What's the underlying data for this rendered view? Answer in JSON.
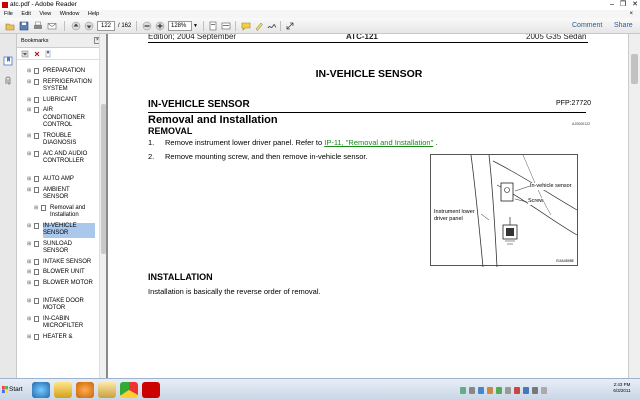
{
  "window": {
    "title": "atc.pdf - Adobe Reader",
    "controls": [
      "–",
      "❐",
      "✕"
    ]
  },
  "menu": {
    "items": [
      "File",
      "Edit",
      "View",
      "Window",
      "Help"
    ],
    "close": "×"
  },
  "toolbar": {
    "current_page": "122",
    "total_pages": "/ 162",
    "zoom": "128%",
    "comment_label": "Comment",
    "share_label": "Share"
  },
  "bookmarks": {
    "title": "Bookmarks",
    "items": [
      {
        "label": "PREPARATION",
        "lines": 1,
        "level": 0,
        "selected": false
      },
      {
        "label": "REFRIGERATION SYSTEM",
        "lines": 2,
        "level": 0,
        "selected": false
      },
      {
        "label": "LUBRICANT",
        "lines": 1,
        "level": 0,
        "selected": false
      },
      {
        "label": "AIR CONDITIONER CONTROL",
        "lines": 3,
        "level": 0,
        "selected": false
      },
      {
        "label": "TROUBLE DIAGNOSIS",
        "lines": 2,
        "level": 0,
        "selected": false
      },
      {
        "label": "A/C AND AUDIO CONTROLLER",
        "lines": 3,
        "level": 0,
        "selected": false
      },
      {
        "label": "AUTO AMP",
        "lines": 1,
        "level": 0,
        "selected": false
      },
      {
        "label": "AMBIENT SENSOR",
        "lines": 2,
        "level": 0,
        "selected": false
      },
      {
        "label": "Removal and Installation",
        "lines": 2,
        "level": 1,
        "selected": false
      },
      {
        "label": "IN-VEHICLE SENSOR",
        "lines": 2,
        "level": 0,
        "selected": true
      },
      {
        "label": "SUNLOAD SENSOR",
        "lines": 2,
        "level": 0,
        "selected": false
      },
      {
        "label": "INTAKE SENSOR",
        "lines": 1,
        "level": 0,
        "selected": false
      },
      {
        "label": "BLOWER UNIT",
        "lines": 1,
        "level": 0,
        "selected": false
      },
      {
        "label": "BLOWER MOTOR",
        "lines": 2,
        "level": 0,
        "selected": false
      },
      {
        "label": "INTAKE DOOR MOTOR",
        "lines": 2,
        "level": 0,
        "selected": false
      },
      {
        "label": "IN-CABIN MICROFILTER",
        "lines": 2,
        "level": 0,
        "selected": false
      },
      {
        "label": "HEATER &",
        "lines": 1,
        "level": 0,
        "selected": false
      }
    ]
  },
  "page": {
    "header_left": "Edition; 2004 September",
    "header_center": "ATC-121",
    "header_right": "2005 G35 Sedan",
    "title": "IN-VEHICLE SENSOR",
    "section": "IN-VEHICLE SENSOR",
    "pfp": "PFP:27720",
    "heading": "Removal and Installation",
    "code": "AJS000122",
    "removal_heading": "REMOVAL",
    "steps": [
      {
        "num": "1.",
        "pre": "Remove instrument lower driver panel. Refer to ",
        "link": "IP-11, \"Removal and Installation\"",
        "post": " ."
      },
      {
        "num": "2.",
        "pre": "Remove mounting screw, and then remove in-vehicle sensor.",
        "link": "",
        "post": ""
      }
    ],
    "diagram": {
      "label_sensor": "In-vehicle sensor",
      "label_screw": "Screw",
      "label_panel_1": "Instrument lower",
      "label_panel_2": "driver panel",
      "code": "RJIA0898E"
    },
    "installation_heading": "INSTALLATION",
    "installation_text": "Installation is basically the reverse order of removal."
  },
  "taskbar": {
    "start_label": "Start",
    "clock_time": "2:43 PM",
    "clock_date": "6/3/2011"
  }
}
